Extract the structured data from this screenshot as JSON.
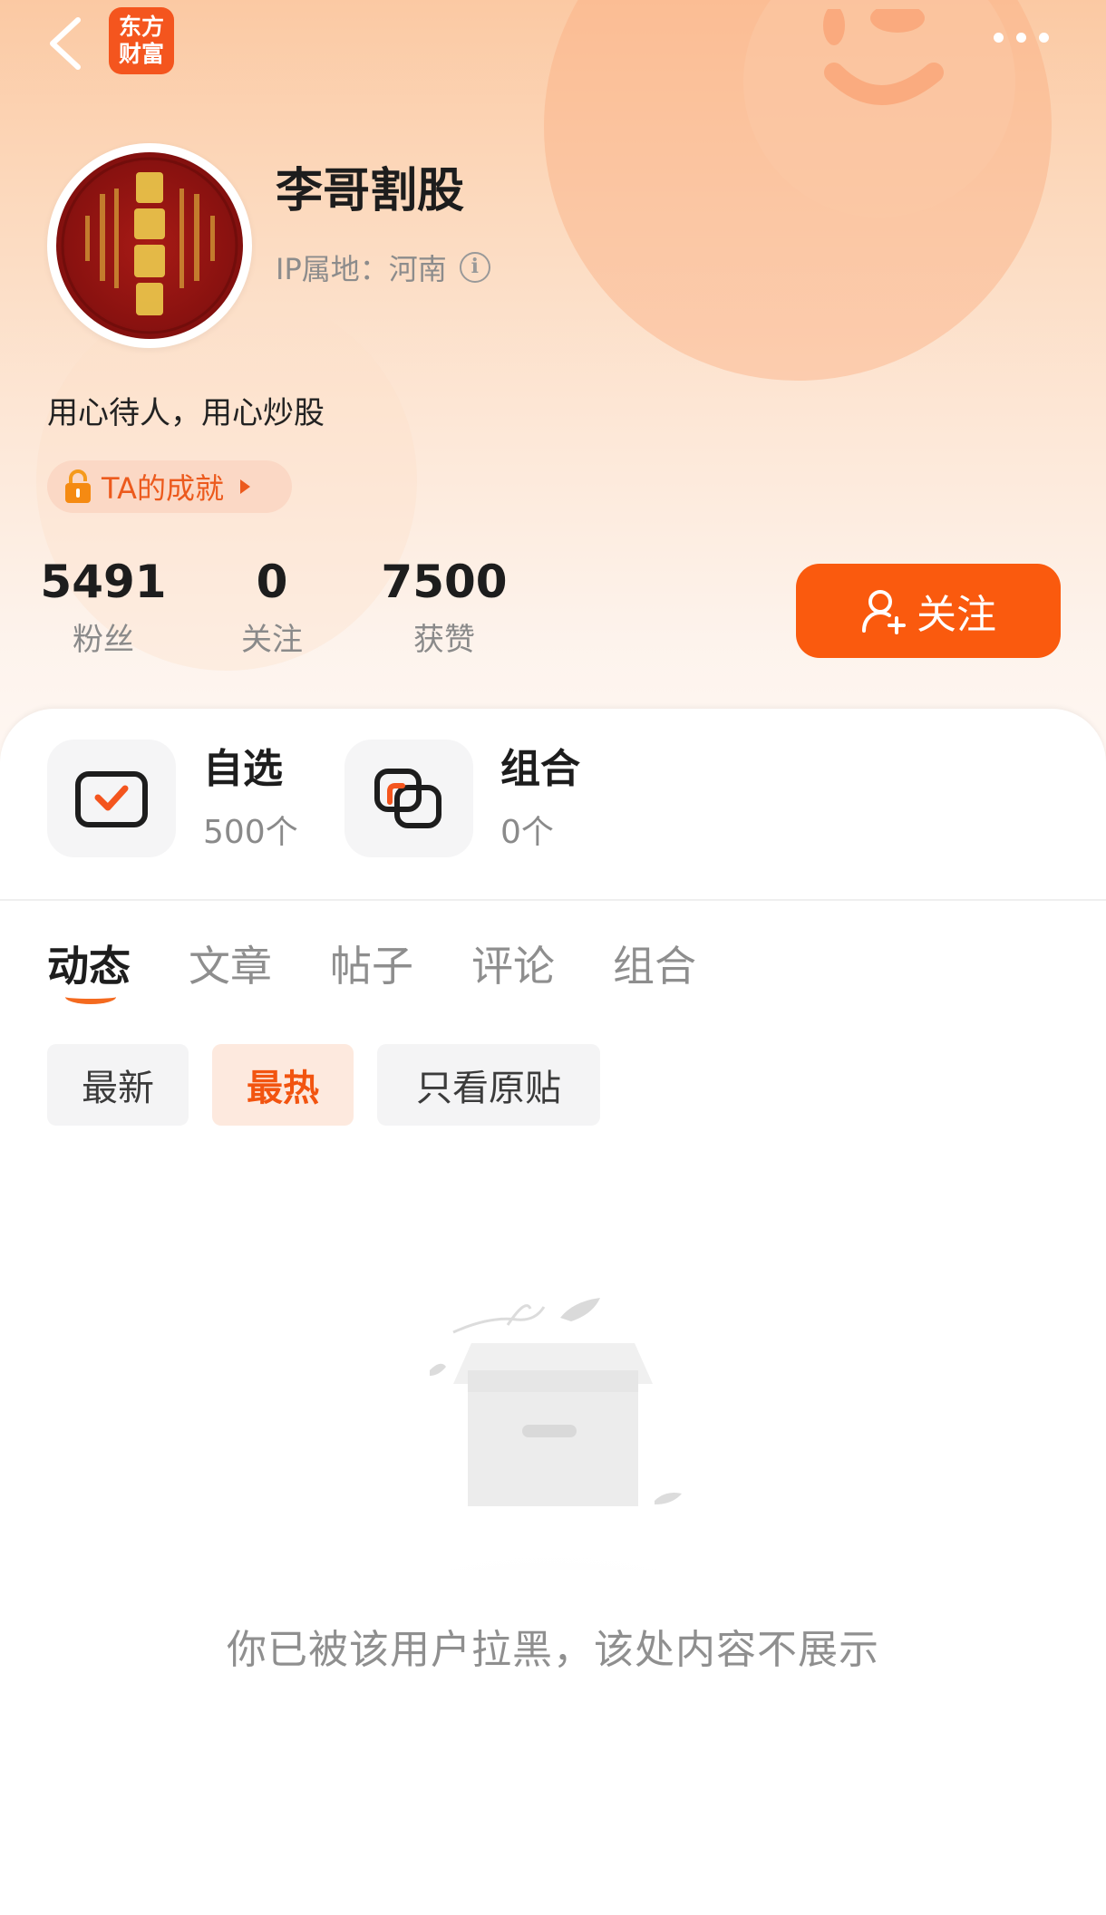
{
  "app": {
    "logo_line1": "东方",
    "logo_line2": "财富",
    "brand_color": "#f4551e"
  },
  "profile": {
    "username": "李哥割股",
    "ip_location": "IP属地：河南",
    "bio": "用心待人，用心炒股",
    "achievements_label": "TA的成就"
  },
  "stats": {
    "fans": {
      "value": "5491",
      "label": "粉丝"
    },
    "following": {
      "value": "0",
      "label": "关注"
    },
    "likes": {
      "value": "7500",
      "label": "获赞"
    }
  },
  "follow_button": {
    "label": "关注",
    "color": "#fa5a0e"
  },
  "quick_links": {
    "watchlist": {
      "title": "自选",
      "count": "500个"
    },
    "combos": {
      "title": "组合",
      "count": "0个"
    }
  },
  "tabs": [
    {
      "label": "动态",
      "active": true
    },
    {
      "label": "文章",
      "active": false
    },
    {
      "label": "帖子",
      "active": false
    },
    {
      "label": "评论",
      "active": false
    },
    {
      "label": "组合",
      "active": false
    }
  ],
  "filters": [
    {
      "label": "最新",
      "active": false
    },
    {
      "label": "最热",
      "active": true
    },
    {
      "label": "只看原贴",
      "active": false
    }
  ],
  "empty_state": {
    "message": "你已被该用户拉黑，该处内容不展示",
    "icon": "empty-box-icon"
  },
  "icons": {
    "back": "chevron-left-icon",
    "more": "more-dots-icon",
    "info": "info-icon",
    "lock": "lock-icon",
    "add_user": "add-user-icon",
    "watchlist": "checkbox-icon",
    "combo": "overlap-squares-icon"
  }
}
